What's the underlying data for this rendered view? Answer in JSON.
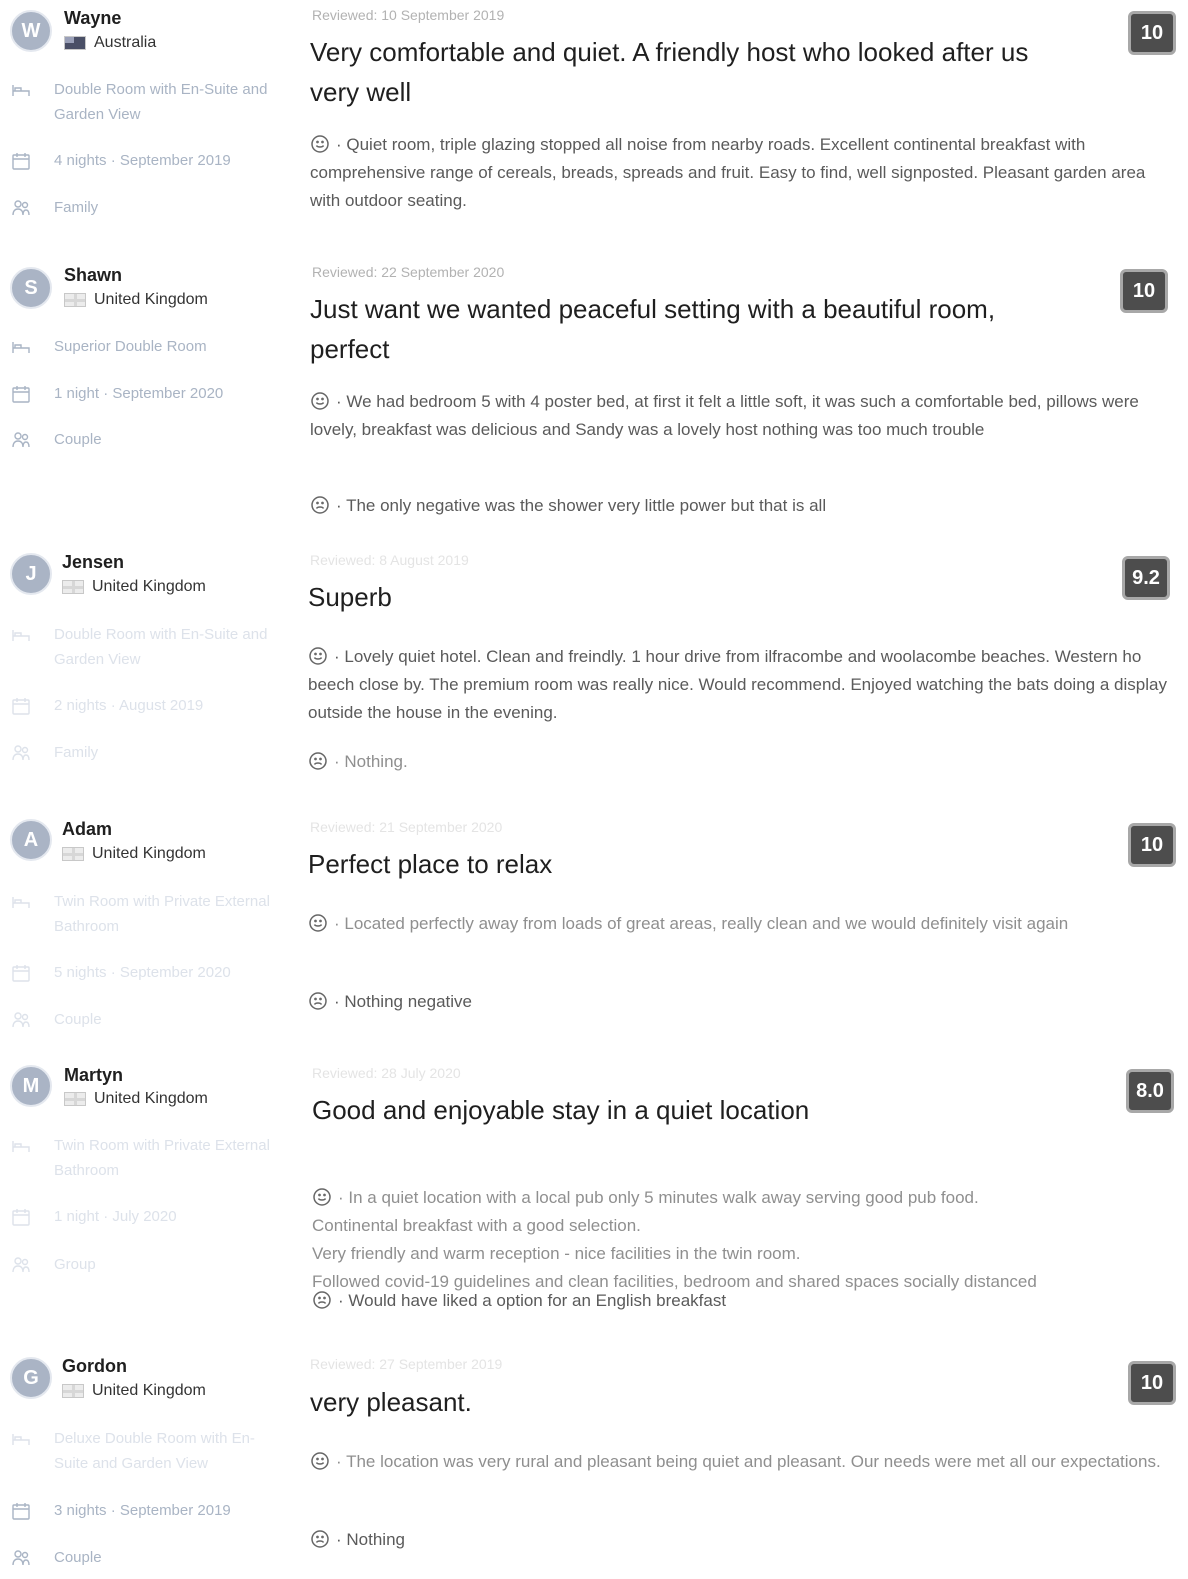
{
  "reviews": [
    {
      "initial": "W",
      "name": "Wayne",
      "country": "Australia",
      "flag": "australia-flag",
      "room": "Double Room with En-Suite and Garden View",
      "stay": "4 nights · September 2019",
      "traveller": "Family",
      "reviewed": "Reviewed: 10 September 2019",
      "title": "Very comfortable and quiet. A friendly host who looked after us very well",
      "score": "10",
      "positive": "· Quiet room, triple glazing stopped all noise from nearby roads. Excellent continental breakfast with comprehensive range of cereals, breads, spreads and fruit. Easy to find, well signposted. Pleasant garden area with outdoor seating.",
      "negative": ""
    },
    {
      "initial": "S",
      "name": "Shawn",
      "country": "United Kingdom",
      "flag": "uk-flag",
      "room": "Superior Double Room",
      "stay": "1 night · September 2020",
      "traveller": "Couple",
      "reviewed": "Reviewed: 22 September 2020",
      "title": "Just want we wanted peaceful setting with a beautiful room, perfect",
      "score": "10",
      "positive": "· We had bedroom 5 with 4 poster bed, at first it felt a little soft, it was such a comfortable bed, pillows were lovely, breakfast was delicious and Sandy was a lovely host nothing was too much trouble",
      "negative": "· The only negative was the shower very little power but that is all"
    },
    {
      "initial": "J",
      "name": "Jensen",
      "country": "United Kingdom",
      "flag": "uk-flag",
      "room": "Double Room with En-Suite and Garden View",
      "stay": "2 nights · August 2019",
      "traveller": "Family",
      "reviewed": "Reviewed: 8 August 2019",
      "title": "Superb",
      "score": "9.2",
      "positive": "· Lovely quiet hotel. Clean and freindly. 1 hour drive from ilfracombe and woolacombe beaches. Western ho beech close by. The premium room was really nice. Would recommend. Enjoyed watching the bats doing a display outside the house in the evening.",
      "negative": "· Nothing."
    },
    {
      "initial": "A",
      "name": "Adam",
      "country": "United Kingdom",
      "flag": "uk-flag",
      "room": "Twin Room with Private External Bathroom",
      "stay": "5 nights · September 2020",
      "traveller": "Couple",
      "reviewed": "Reviewed: 21 September 2020",
      "title": "Perfect place to relax",
      "score": "10",
      "positive": "· Located perfectly away from loads of great areas, really clean and we would definitely visit again",
      "negative": "· Nothing negative"
    },
    {
      "initial": "M",
      "name": "Martyn",
      "country": "United Kingdom",
      "flag": "uk-flag",
      "room": "Twin Room with Private External Bathroom",
      "stay": "1 night · July 2020",
      "traveller": "Group",
      "reviewed": "Reviewed: 28 July 2020",
      "title": "Good and enjoyable stay in a quiet location",
      "score": "8.0",
      "positive": "· In a quiet location with a local pub only 5 minutes walk away serving good pub food.\nContinental breakfast with a good selection.\nVery friendly and warm reception - nice facilities in the twin room.\nFollowed covid-19 guidelines and clean facilities, bedroom and shared spaces socially distanced",
      "negative": "· Would have liked a option for an English breakfast"
    },
    {
      "initial": "G",
      "name": "Gordon",
      "country": "United Kingdom",
      "flag": "uk-flag",
      "room": "Deluxe Double Room with En-Suite and Garden View",
      "stay": "3 nights · September 2019",
      "traveller": "Couple",
      "reviewed": "Reviewed: 27 September 2019",
      "title": "very pleasant.",
      "score": "10",
      "positive": "· The location was very rural and pleasant being quiet and pleasant. Our needs were met all our expectations.",
      "negative": "· Nothing"
    }
  ]
}
